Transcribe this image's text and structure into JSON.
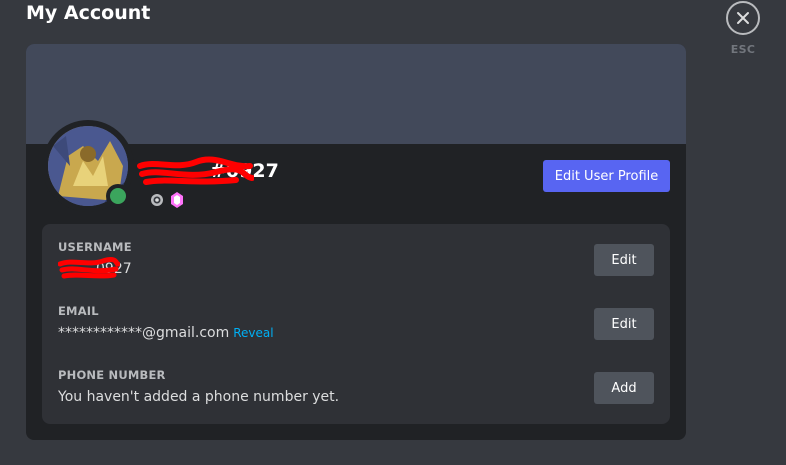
{
  "page": {
    "title": "My Account",
    "close_label": "ESC"
  },
  "profile": {
    "tag": "#0927",
    "edit_profile_label": "Edit User Profile",
    "badges": [
      "hypesquad-icon",
      "nitro-boost-icon"
    ],
    "status_color": "#3ba55d",
    "accent_color": "#5865f2"
  },
  "fields": {
    "username": {
      "label": "USERNAME",
      "value": "0927",
      "button": "Edit"
    },
    "email": {
      "label": "EMAIL",
      "value": "************@gmail.com",
      "reveal": "Reveal",
      "button": "Edit"
    },
    "phone": {
      "label": "PHONE NUMBER",
      "value": "You haven't added a phone number yet.",
      "button": "Add"
    }
  }
}
